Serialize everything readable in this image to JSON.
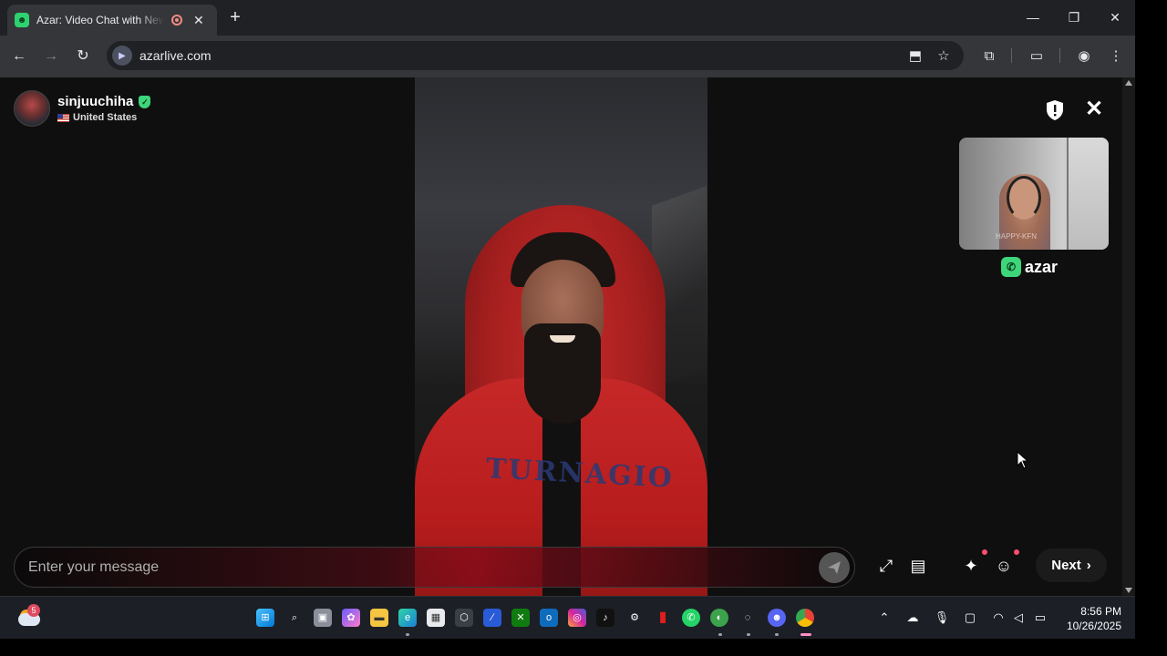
{
  "browser": {
    "tab_title": "Azar: Video Chat with New",
    "new_tab": "+",
    "url": "azarlive.com",
    "window_controls": {
      "minimize": "—",
      "restore": "❐",
      "close": "✕"
    }
  },
  "chat": {
    "partner": {
      "name": "sinjuuchiha",
      "country": "United States"
    },
    "self_watermark": "HAPPY-KFN",
    "brand": "azar",
    "remote_video_text": "TURNAGIO",
    "message_placeholder": "Enter your message",
    "next_label": "Next",
    "accent_color": "#3dd67a",
    "notification_dot_color": "#ff4d6d"
  },
  "taskbar": {
    "weather_badge": "5",
    "time": "8:56 PM",
    "date": "10/26/2025"
  }
}
